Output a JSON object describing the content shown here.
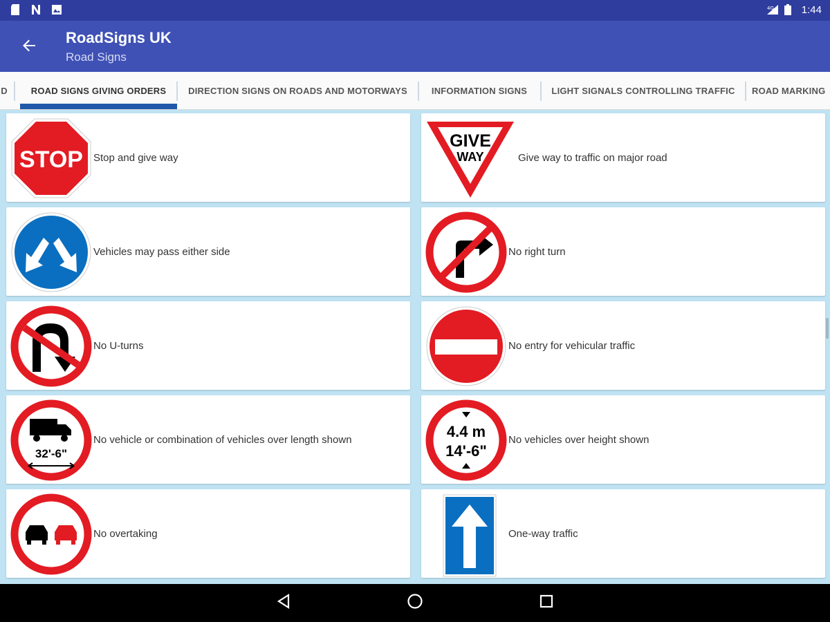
{
  "status_bar": {
    "time": "1:44",
    "left_icons": [
      "sd-card-icon",
      "n-letter-icon",
      "image-icon"
    ],
    "right_icons": [
      "signal-icon",
      "battery-icon"
    ]
  },
  "app_bar": {
    "title": "RoadSigns UK",
    "subtitle": "Road Signs",
    "back_icon": "arrow-left-icon"
  },
  "tabs": [
    {
      "label": "D",
      "active": false
    },
    {
      "label": "ROAD SIGNS GIVING ORDERS",
      "active": true
    },
    {
      "label": "DIRECTION SIGNS ON ROADS AND MOTORWAYS",
      "active": false
    },
    {
      "label": "INFORMATION SIGNS",
      "active": false
    },
    {
      "label": "LIGHT SIGNALS CONTROLLING TRAFFIC",
      "active": false
    },
    {
      "label": "ROAD MARKING",
      "active": false
    }
  ],
  "signs": [
    {
      "label": "Stop and give way",
      "icon": "stop-sign-icon",
      "sign_text": "STOP"
    },
    {
      "label": "Give way to traffic on major road",
      "icon": "give-way-sign-icon",
      "sign_text_1": "GIVE",
      "sign_text_2": "WAY"
    },
    {
      "label": "Vehicles may pass either side",
      "icon": "pass-either-side-sign-icon"
    },
    {
      "label": "No right turn",
      "icon": "no-right-turn-sign-icon"
    },
    {
      "label": "No U-turns",
      "icon": "no-u-turn-sign-icon"
    },
    {
      "label": "No entry for vehicular traffic",
      "icon": "no-entry-sign-icon"
    },
    {
      "label": "No vehicle or combination of vehicles over length shown",
      "icon": "length-limit-sign-icon",
      "sign_text": "32'-6\""
    },
    {
      "label": "No vehicles over height shown",
      "icon": "height-limit-sign-icon",
      "sign_text_1": "4.4 m",
      "sign_text_2": "14'-6\""
    },
    {
      "label": "No overtaking",
      "icon": "no-overtaking-sign-icon"
    },
    {
      "label": "One-way traffic",
      "icon": "one-way-sign-icon"
    }
  ],
  "colors": {
    "status_bar": "#2f3d9f",
    "app_bar": "#3f51b5",
    "tab_indicator": "#2059a9",
    "background": "#bfe3f3",
    "sign_red": "#e31b23",
    "sign_blue": "#0a6fc0"
  },
  "nav_bar": {
    "back": "triangle-back-icon",
    "home": "circle-home-icon",
    "recents": "square-recents-icon"
  }
}
